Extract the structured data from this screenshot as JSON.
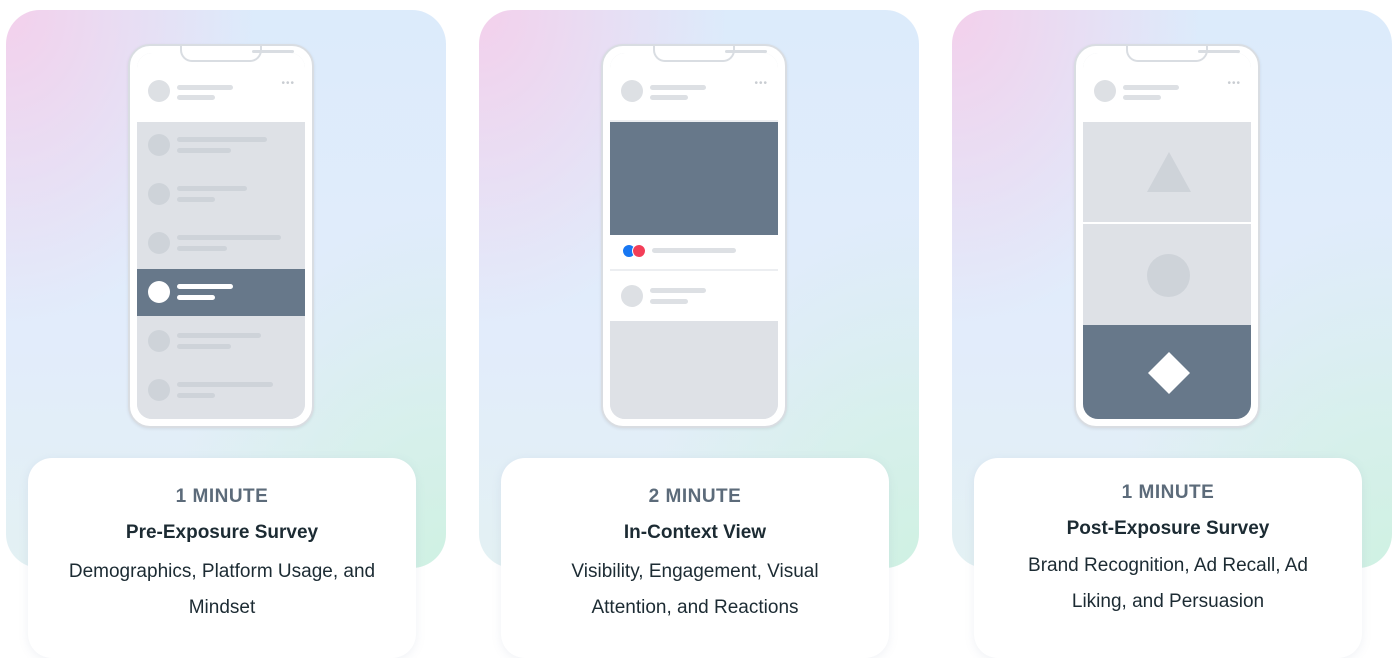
{
  "colors": {
    "accent_dark": "#67788a",
    "placeholder": "#d0d5db",
    "text_primary": "#1c2b33",
    "text_secondary": "#5c6b7a"
  },
  "panels": [
    {
      "duration": "1 MINUTE",
      "title": "Pre-Exposure Survey",
      "description": "Demographics, Platform Usage, and Mindset",
      "phone_content": "survey-list",
      "highlighted_row": 4
    },
    {
      "duration": "2 MINUTE",
      "title": "In-Context View",
      "description": "Visibility, Engagement, Visual Attention, and Reactions",
      "phone_content": "feed-post"
    },
    {
      "duration": "1 MINUTE",
      "title": "Post-Exposure Survey",
      "description": "Brand Recognition, Ad Recall, Ad Liking, and Persuasion",
      "phone_content": "shape-options",
      "shapes": [
        "triangle-icon",
        "circle-icon",
        "diamond-icon"
      ]
    }
  ]
}
